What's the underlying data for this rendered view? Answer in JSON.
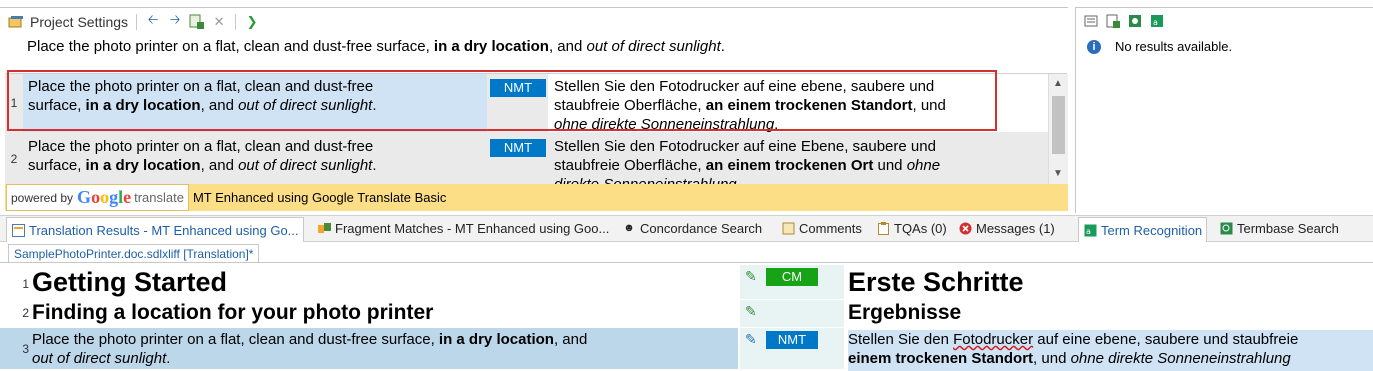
{
  "translation_results": {
    "toolbar": {
      "project_settings_label": "Project Settings"
    },
    "source_preview": {
      "part1": "Place the photo printer on a flat, clean and dust-free surface, ",
      "bold": "in a dry location",
      "part2": ", and ",
      "italic": "out of direct sunlight",
      "part3": "."
    },
    "rows": [
      {
        "number": "1",
        "source_line1": "Place the photo printer on a flat, clean and dust-free",
        "source_line2_a": "surface, ",
        "source_bold": "in a dry location",
        "source_line2_b": ", and ",
        "source_italic": "out of direct sunlight",
        "source_end": ".",
        "origin": "NMT",
        "target_line1": "Stellen Sie den Fotodrucker auf eine ebene, saubere und",
        "target_line2_a": "staubfreie Oberfläche, ",
        "target_bold": "an einem trockenen Standort",
        "target_line2_b": ", und",
        "target_italic": "ohne direkte Sonneneinstrahlung",
        "target_end": "."
      },
      {
        "number": "2",
        "source_line1": "Place the photo printer on a flat, clean and dust-free",
        "source_line2_a": "surface, ",
        "source_bold": "in a dry location",
        "source_line2_b": ", and ",
        "source_italic": "out of direct sunlight",
        "source_end": ".",
        "origin": "NMT",
        "target_line1": "Stellen Sie den Fotodrucker auf eine Ebene, saubere und",
        "target_line2_a": "staubfreie Oberfläche, ",
        "target_bold": "an einem trockenen Ort",
        "target_line2_b": " und ",
        "target_italic": "ohne",
        "target_line3": "direkte Sonneneinstrahlung"
      }
    ],
    "provider_bar": {
      "powered_by": "powered by",
      "google": "Google",
      "translate": "translate",
      "text": "MT Enhanced using Google Translate Basic"
    }
  },
  "term_pane": {
    "message": "No results available."
  },
  "tabs": [
    {
      "label": "Translation Results - MT Enhanced using Go..."
    },
    {
      "label": "Fragment Matches - MT Enhanced using Goo..."
    },
    {
      "label": "Concordance Search"
    },
    {
      "label": "Comments"
    },
    {
      "label": "TQAs (0)"
    },
    {
      "label": "Messages (1)"
    },
    {
      "label": "Term Recognition"
    },
    {
      "label": "Termbase Search"
    }
  ],
  "document": {
    "tab_label": "SamplePhotoPrinter.doc.sdlxliff [Translation]*",
    "rows": [
      {
        "number": "1",
        "source": "Getting Started",
        "status": "CM",
        "target": "Erste Schritte"
      },
      {
        "number": "2",
        "source": "Finding a location for your photo printer",
        "status": "",
        "target": "Ergebnisse"
      },
      {
        "number": "3",
        "source_a": "Place the photo printer on a flat, clean and dust-free surface, ",
        "source_bold": "in a dry location",
        "source_b": ", and",
        "source_italic": "out of direct sunlight",
        "source_end": ".",
        "status": "NMT",
        "target_a": "Stellen Sie den ",
        "target_squiggle": "Fotodrucker",
        "target_b": " auf eine ebene, saubere und staubfreie",
        "target_bold": "einem trockenen Standort",
        "target_c": ", und ",
        "target_italic": "ohne direkte Sonneneinstrahlung"
      }
    ]
  },
  "colors": {
    "accent": "#0078c8",
    "cm_badge": "#16a316",
    "highlight_box": "#d43030",
    "provider_bar": "#fbde86",
    "row_active": "#bcd6ea"
  }
}
